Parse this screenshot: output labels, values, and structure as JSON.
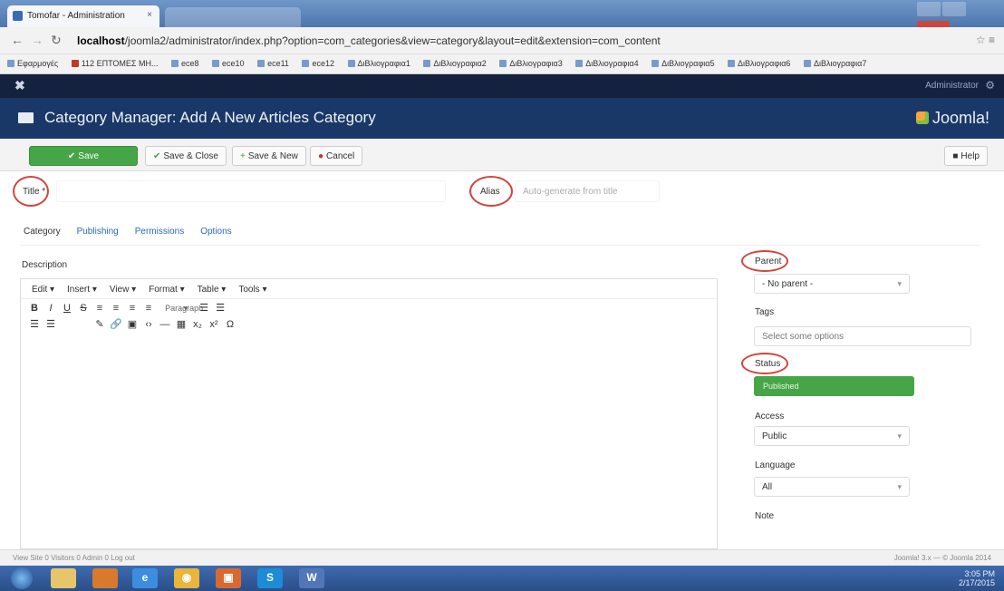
{
  "browser": {
    "tab_title": "Tomofar - Administration",
    "tab_close": "×",
    "url_host": "localhost",
    "url_path": "/joomla2/administrator/index.php?option=com_categories&view=category&layout=edit&extension=com_content",
    "bookmarks": [
      "Εφαρμογές",
      "112 ΕΠΤΟΜΕΣ ΜΗ...",
      "ece8",
      "ece10",
      "ece11",
      "ece12",
      "ΔιΒλιογραφια1",
      "ΔιΒλιογραφια2",
      "ΔιΒλιογραφια3",
      "ΔιΒλιογραφια4",
      "ΔιΒλιογραφια5",
      "ΔιΒλιογραφια6",
      "ΔιΒλιογραφια7"
    ]
  },
  "joomla": {
    "top_user": "Administrator",
    "page_title": "Category Manager: Add A New Articles Category",
    "logo_text": "Joomla!"
  },
  "toolbar": {
    "save": "Save",
    "save_close": "Save & Close",
    "save_new": "Save & New",
    "cancel": "Cancel",
    "help": "Help"
  },
  "form": {
    "title_label": "Title *",
    "alias_label": "Alias",
    "alias_placeholder": "Auto-generate from title",
    "tabs": [
      "Category",
      "Publishing",
      "Permissions",
      "Options"
    ],
    "description_label": "Description"
  },
  "editor": {
    "menus": [
      "Edit ▾",
      "Insert ▾",
      "View ▾",
      "Format ▾",
      "Table ▾",
      "Tools ▾"
    ],
    "row1": [
      "B",
      "I",
      "U",
      "S",
      "≡",
      "≡",
      "≡",
      "≡"
    ],
    "paragraph": "Paragraph",
    "row1_tail": [
      "☰",
      "☰"
    ],
    "row2": [
      "☰",
      "☰",
      "",
      "",
      "✎",
      "🔗",
      "▣",
      "‹›",
      "—",
      "▦",
      "x₂",
      "x²",
      "Ω"
    ]
  },
  "sidebar": {
    "parent_label": "Parent",
    "parent_value": "- No parent -",
    "tags_label": "Tags",
    "tags_placeholder": "Select some options",
    "status_label": "Status",
    "status_value": "Published",
    "access_label": "Access",
    "access_value": "Public",
    "language_label": "Language",
    "language_value": "All",
    "note_label": "Note"
  },
  "statusbar": {
    "left": "View Site   0 Visitors   0 Admin   0   Log out",
    "right": "Joomla! 3.x — © Joomla 2014"
  },
  "taskbar": {
    "clock_time": "3:05 PM",
    "clock_date": "2/17/2015"
  },
  "colors": {
    "joomla_header": "#1a3867",
    "save_green": "#46a546",
    "annotation_red": "#d0463b"
  }
}
